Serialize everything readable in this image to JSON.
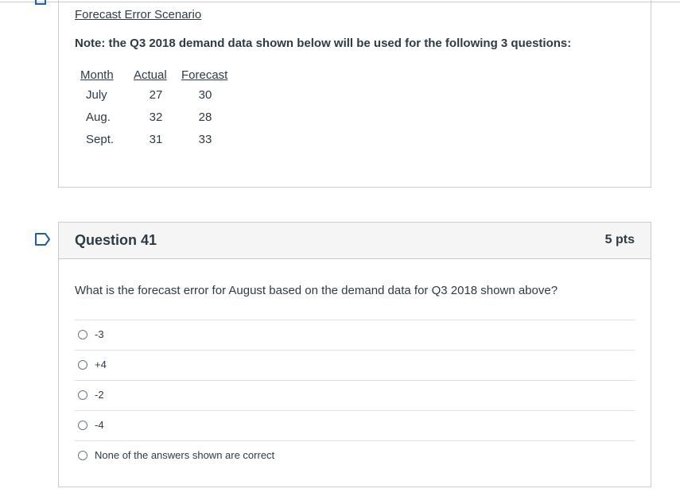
{
  "scenario": {
    "title": "Forecast Error Scenario",
    "note": "Note: the Q3 2018 demand data shown below will be used for the following 3 questions:",
    "table": {
      "headers": [
        "Month",
        "Actual",
        "Forecast"
      ],
      "rows": [
        [
          "July",
          "27",
          "30"
        ],
        [
          "Aug.",
          "32",
          "28"
        ],
        [
          "Sept.",
          "31",
          "33"
        ]
      ]
    }
  },
  "question": {
    "title": "Question 41",
    "points": "5 pts",
    "text": "What is the forecast error for August based on the demand data for Q3 2018 shown above?",
    "answers": [
      "-3",
      "+4",
      "-2",
      "-4",
      "None of the answers shown are correct"
    ]
  },
  "colors": {
    "flag": "#1f5fa8",
    "border": "#c7cdd1",
    "header_bg": "#f5f5f5",
    "text": "#2d3b45"
  },
  "icons": {
    "question_flag": "bookmark-flag-icon"
  }
}
